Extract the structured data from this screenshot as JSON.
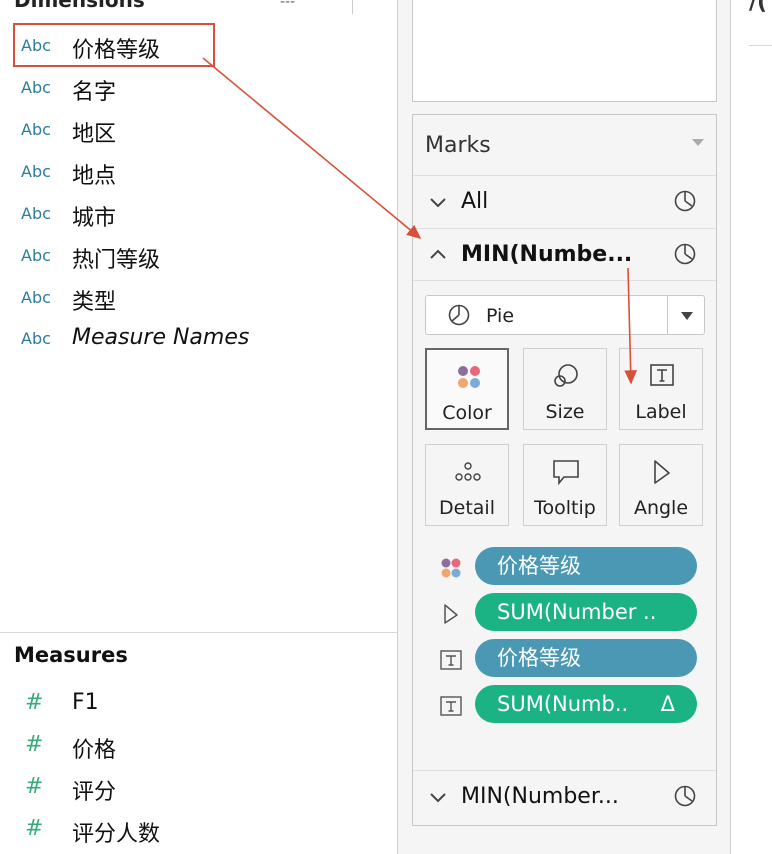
{
  "dimensions": {
    "header": "Dimensions",
    "tools_text": "---",
    "fields": [
      {
        "type": "Abc",
        "name": "价格等级"
      },
      {
        "type": "Abc",
        "name": "名字"
      },
      {
        "type": "Abc",
        "name": "地区"
      },
      {
        "type": "Abc",
        "name": "地点"
      },
      {
        "type": "Abc",
        "name": "城市"
      },
      {
        "type": "Abc",
        "name": "热门等级"
      },
      {
        "type": "Abc",
        "name": "类型"
      },
      {
        "type": "Abc",
        "name": "Measure Names"
      }
    ]
  },
  "measures": {
    "header": "Measures",
    "fields": [
      {
        "type": "#",
        "name": "F1"
      },
      {
        "type": "#",
        "name": "价格"
      },
      {
        "type": "#",
        "name": "评分"
      },
      {
        "type": "#",
        "name": "评分人数"
      }
    ]
  },
  "marks": {
    "title": "Marks",
    "layers": [
      {
        "chevron": "⌄",
        "name": "All"
      },
      {
        "chevron": "⌃",
        "name": "MIN(Numbe..."
      },
      {
        "chevron": "⌄",
        "name": "MIN(Number..."
      }
    ],
    "mark_type": "Pie",
    "buttons": [
      {
        "label": "Color"
      },
      {
        "label": "Size"
      },
      {
        "label": "Label"
      },
      {
        "label": "Detail"
      },
      {
        "label": "Tooltip"
      },
      {
        "label": "Angle"
      }
    ],
    "pills": [
      {
        "label": "价格等级",
        "color": "#4a98b4"
      },
      {
        "label": "SUM(Number ..",
        "color": "#1bb383"
      },
      {
        "label": "价格等级",
        "color": "#4a98b4"
      },
      {
        "label": "SUM(Numb..",
        "color": "#1bb383",
        "badge": "Δ"
      }
    ]
  },
  "right_panel": {
    "header_partial": "/("
  },
  "colors": {
    "annotation": "#d9503a",
    "dimension_type": "#2c7d9a",
    "measure_type": "#3aaa7a"
  }
}
